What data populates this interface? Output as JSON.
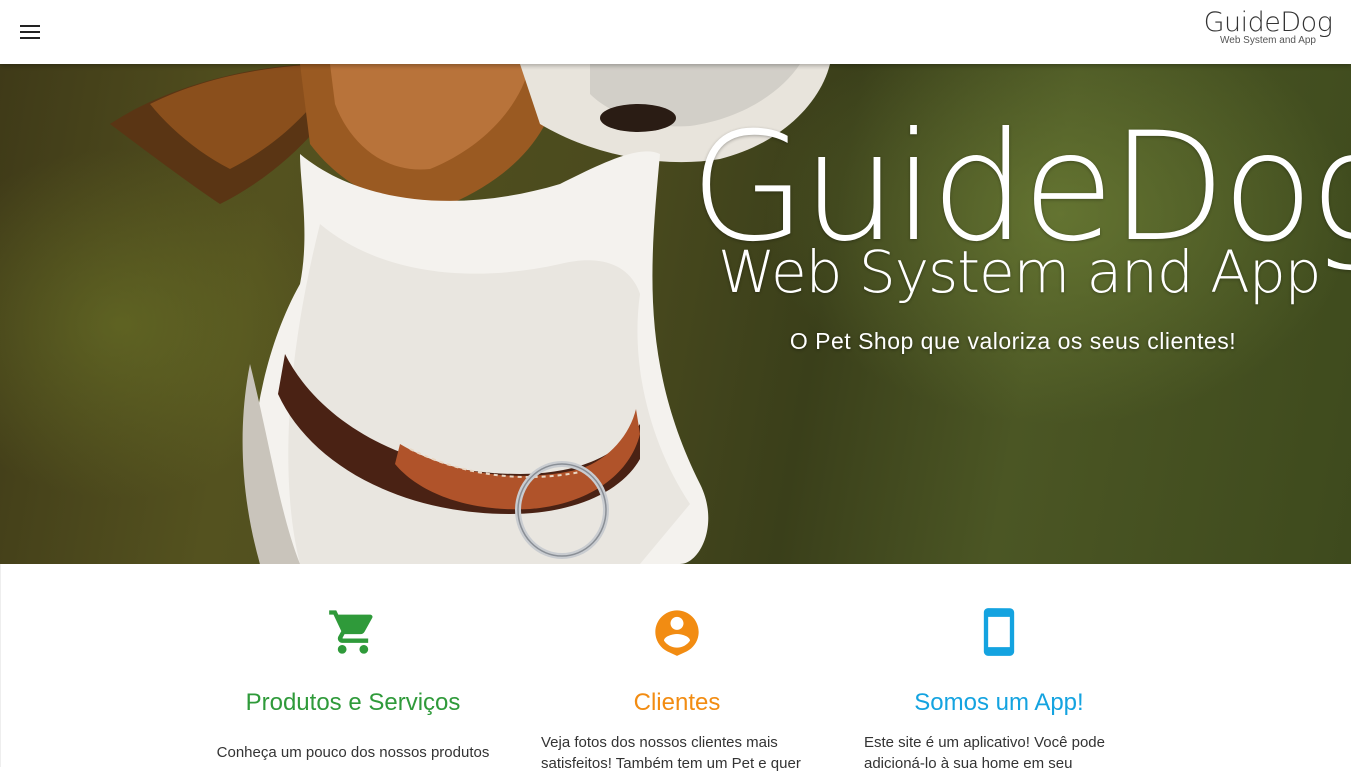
{
  "header": {
    "menu_icon": "menu-icon",
    "brand_name": "GuideDog",
    "brand_tagline": "Web System and App"
  },
  "hero": {
    "title": "GuideDog",
    "subtitle": "Web System and App",
    "tagline": "O Pet Shop que valoriza os seus clientes!"
  },
  "features": [
    {
      "icon": "shopping-cart-icon",
      "color": "#2f9a3a",
      "title": "Produtos e Serviços",
      "text": "Conheça um pouco dos nossos produtos"
    },
    {
      "icon": "account-circle-icon",
      "color": "#f28c12",
      "title": "Clientes",
      "text": "Veja fotos dos nossos clientes mais satisfeitos! Também tem um Pet e quer"
    },
    {
      "icon": "smartphone-icon",
      "color": "#14a3e0",
      "title": "Somos um App!",
      "text": "Este site é um aplicativo! Você pode adicioná-lo à sua home em seu"
    }
  ]
}
